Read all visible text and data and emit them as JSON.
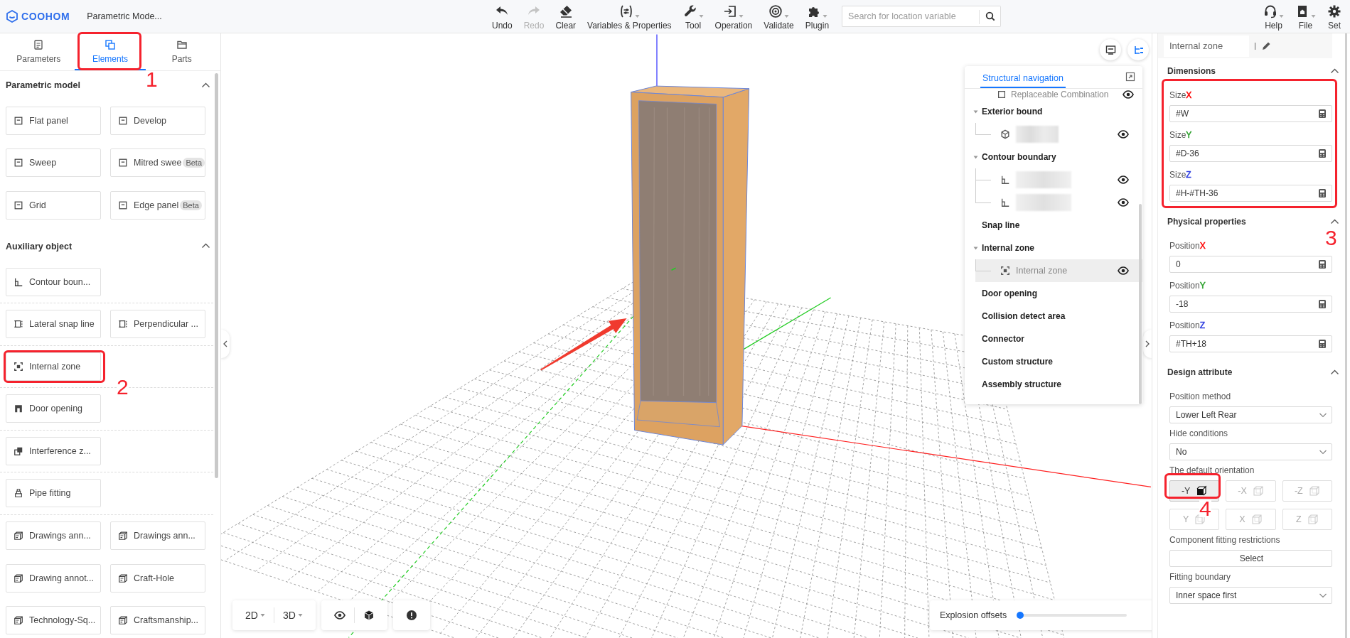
{
  "topbar": {
    "logo": "COOHOM",
    "document_title": "Parametric Mode...",
    "tools": [
      {
        "kind": "undo",
        "label": "Undo",
        "disabled": false,
        "dropdown": false
      },
      {
        "kind": "redo",
        "label": "Redo",
        "disabled": true,
        "dropdown": false
      },
      {
        "kind": "clear",
        "label": "Clear",
        "disabled": false,
        "dropdown": false
      },
      {
        "kind": "variables",
        "label": "Variables & Properties",
        "disabled": false,
        "dropdown": true
      },
      {
        "kind": "tool",
        "label": "Tool",
        "disabled": false,
        "dropdown": true
      },
      {
        "kind": "operation",
        "label": "Operation",
        "disabled": false,
        "dropdown": true
      },
      {
        "kind": "validate",
        "label": "Validate",
        "disabled": false,
        "dropdown": true
      },
      {
        "kind": "plugin",
        "label": "Plugin",
        "disabled": false,
        "dropdown": true
      }
    ],
    "search": {
      "placeholder": "Search for location variable"
    },
    "right_tools": [
      {
        "kind": "help",
        "label": "Help",
        "dropdown": true
      },
      {
        "kind": "file",
        "label": "File",
        "dropdown": true
      },
      {
        "kind": "settings",
        "label": "Set",
        "dropdown": false
      }
    ]
  },
  "left_panel": {
    "tabs": [
      {
        "kind": "parameters",
        "label": "Parameters",
        "selected": false
      },
      {
        "kind": "elements",
        "label": "Elements",
        "selected": true
      },
      {
        "kind": "parts",
        "label": "Parts",
        "selected": false
      }
    ],
    "sections": [
      {
        "title": "Parametric model",
        "expanded": true,
        "rows": [
          {
            "divided": false,
            "items": [
              {
                "kind": "panel",
                "label": "Flat panel"
              },
              {
                "kind": "panel",
                "label": "Develop"
              }
            ]
          },
          {
            "divided": false,
            "items": [
              {
                "kind": "panel",
                "label": "Sweep"
              },
              {
                "kind": "panel",
                "label": "Mitred swee",
                "badge": "Beta"
              }
            ]
          },
          {
            "divided": false,
            "items": [
              {
                "kind": "panel",
                "label": "Grid"
              },
              {
                "kind": "panel",
                "label": "Edge panel",
                "badge": "Beta"
              }
            ]
          }
        ]
      },
      {
        "title": "Auxiliary object",
        "expanded": true,
        "rows": [
          {
            "divided": true,
            "items": [
              {
                "kind": "contour",
                "label": "Contour boun..."
              }
            ]
          },
          {
            "divided": true,
            "items": [
              {
                "kind": "snap",
                "label": "Lateral snap line"
              },
              {
                "kind": "snap",
                "label": "Perpendicular ..."
              }
            ]
          },
          {
            "divided": true,
            "items": [
              {
                "kind": "zone",
                "label": "Internal zone"
              }
            ]
          },
          {
            "divided": true,
            "items": [
              {
                "kind": "door",
                "label": "Door opening"
              }
            ]
          },
          {
            "divided": true,
            "items": [
              {
                "kind": "interference",
                "label": "Interference z..."
              }
            ]
          },
          {
            "divided": true,
            "items": [
              {
                "kind": "pipe",
                "label": "Pipe fitting"
              }
            ]
          },
          {
            "divided": false,
            "items": [
              {
                "kind": "annotation",
                "label": "Drawings ann..."
              },
              {
                "kind": "annotation",
                "label": "Drawings ann..."
              }
            ]
          },
          {
            "divided": false,
            "items": [
              {
                "kind": "annotation",
                "label": "Drawing annot..."
              },
              {
                "kind": "annotation",
                "label": "Craft-Hole"
              }
            ]
          },
          {
            "divided": false,
            "items": [
              {
                "kind": "annotation",
                "label": "Technology-Sq..."
              },
              {
                "kind": "annotation",
                "label": "Craftsmanship..."
              }
            ]
          }
        ]
      }
    ]
  },
  "viewport": {
    "nav_panel": {
      "tab": "Structural navigation",
      "tree": [
        {
          "kind": "combination",
          "label": "Replaceable Combination",
          "visible": true,
          "selected": false
        },
        {
          "kind": "group",
          "label": "Exterior bound",
          "expanded": true,
          "selected": false,
          "children": [
            {
              "kind": "model",
              "redacted": true,
              "visible": true,
              "selected": false
            }
          ]
        },
        {
          "kind": "group",
          "label": "Contour boundary",
          "expanded": true,
          "selected": false,
          "children": [
            {
              "kind": "contour",
              "redacted": true,
              "visible": true,
              "selected": false
            },
            {
              "kind": "contour",
              "redacted": true,
              "visible": true,
              "selected": false
            }
          ]
        },
        {
          "kind": "group",
          "label": "Snap line",
          "selected": false
        },
        {
          "kind": "group",
          "label": "Internal zone",
          "expanded": true,
          "selected": false,
          "children": [
            {
              "kind": "zone",
              "label": "Internal zone",
              "visible": true,
              "selected": true
            }
          ]
        },
        {
          "kind": "group",
          "label": "Door opening",
          "selected": false
        },
        {
          "kind": "group",
          "label": "Collision detect area",
          "selected": false
        },
        {
          "kind": "group",
          "label": "Connector",
          "selected": false
        },
        {
          "kind": "group",
          "label": "Custom structure",
          "selected": false
        },
        {
          "kind": "group",
          "label": "Assembly structure",
          "selected": false
        }
      ]
    },
    "view_toolbar": [
      [
        {
          "kind": "mode",
          "label": "2D",
          "dropdown": true
        },
        {
          "kind": "mode",
          "label": "3D",
          "dropdown": true
        }
      ],
      [
        {
          "kind": "visibility"
        },
        {
          "kind": "cube"
        }
      ],
      [
        {
          "kind": "alert"
        }
      ]
    ],
    "explosion": {
      "label": "Explosion offsets",
      "level": 0
    }
  },
  "properties": {
    "name": "Internal zone",
    "sections": [
      {
        "title": "Dimensions",
        "expanded": true,
        "fields": [
          {
            "kind": "formula",
            "label": "Size",
            "axis": "X",
            "color": "#ff0000",
            "value": "#W"
          },
          {
            "kind": "formula",
            "label": "Size",
            "axis": "Y",
            "color": "#2ea12e",
            "value": "#D-36"
          },
          {
            "kind": "formula",
            "label": "Size",
            "axis": "Z",
            "color": "#2f3fe0",
            "value": "#H-#TH-36"
          }
        ]
      },
      {
        "title": "Physical properties",
        "expanded": true,
        "fields": [
          {
            "kind": "formula",
            "label": "Position",
            "axis": "X",
            "color": "#ff0000",
            "value": "0"
          },
          {
            "kind": "formula",
            "label": "Position",
            "axis": "Y",
            "color": "#2ea12e",
            "value": "-18"
          },
          {
            "kind": "formula",
            "label": "Position",
            "axis": "Z",
            "color": "#2f3fe0",
            "value": "#TH+18"
          }
        ]
      },
      {
        "title": "Design attribute",
        "expanded": true,
        "fields": [
          {
            "kind": "select",
            "label": "Position method",
            "value": "Lower Left Rear"
          },
          {
            "kind": "select",
            "label": "Hide conditions",
            "value": "No"
          },
          {
            "kind": "orientation",
            "label": "The default orientation",
            "options": [
              {
                "label": "-Y",
                "selected": true
              },
              {
                "label": "-X",
                "selected": false
              },
              {
                "label": "-Z",
                "selected": false
              },
              {
                "label": "Y",
                "selected": false
              },
              {
                "label": "X",
                "selected": false
              },
              {
                "label": "Z",
                "selected": false
              }
            ]
          },
          {
            "kind": "button",
            "label": "Component fitting restrictions",
            "value": "Select"
          },
          {
            "kind": "select",
            "label": "Fitting boundary",
            "value": "Inner space first"
          }
        ]
      }
    ]
  },
  "annotations": [
    {
      "label": "1"
    },
    {
      "label": "2"
    },
    {
      "label": "3"
    },
    {
      "label": "4"
    }
  ]
}
